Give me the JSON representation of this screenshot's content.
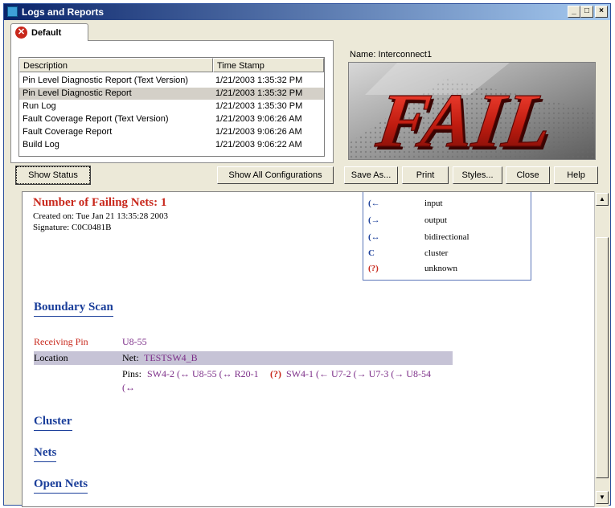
{
  "window": {
    "title": "Logs and Reports"
  },
  "tabs": [
    {
      "label": "Default"
    }
  ],
  "list": {
    "columns": [
      "Description",
      "Time Stamp"
    ],
    "rows": [
      {
        "description": "Pin Level Diagnostic Report (Text Version)",
        "time": "1/21/2003 1:35:32 PM"
      },
      {
        "description": "Pin Level Diagnostic Report",
        "time": "1/21/2003 1:35:32 PM",
        "selected": true
      },
      {
        "description": "Run Log",
        "time": "1/21/2003 1:35:30 PM"
      },
      {
        "description": "Fault Coverage Report (Text Version)",
        "time": "1/21/2003 9:06:26 AM"
      },
      {
        "description": "Fault Coverage Report",
        "time": "1/21/2003 9:06:26 AM"
      },
      {
        "description": "Build Log",
        "time": "1/21/2003 9:06:22 AM"
      }
    ]
  },
  "preview": {
    "name_label": "Name: Interconnect1",
    "fail_text": "FAIL"
  },
  "buttons": {
    "show_status": "Show Status",
    "show_all": "Show All Configurations",
    "save_as": "Save As...",
    "print": "Print",
    "styles": "Styles...",
    "close": "Close",
    "help": "Help"
  },
  "report": {
    "heading": "Number of Failing Nets: 1",
    "created": "Created on: Tue Jan 21 13:35:28 2003",
    "signature": "Signature: C0C0481B",
    "legend": [
      {
        "symbol": "(←",
        "label": "input"
      },
      {
        "symbol": "(→",
        "label": "output"
      },
      {
        "symbol": "(↔",
        "label": "bidirectional"
      },
      {
        "symbol": "C",
        "label": "cluster"
      },
      {
        "symbol": "(?)",
        "label": "unknown"
      }
    ],
    "boundary_scan": "Boundary Scan",
    "receiving_pin_label": "Receiving Pin",
    "receiving_pin_value": "U8-55",
    "location_label": "Location",
    "net_label": "Net:",
    "net_value": "TESTSW4_B",
    "pins_label": "Pins:",
    "pins_line1": "SW4-2 (↔ U8-55 (↔ R20-1",
    "pins_unknown": "(?)",
    "pins_line1b": "SW4-1 (← U7-2 (→ U7-3 (→ U8-54",
    "pins_line2": "(↔",
    "cluster": "Cluster",
    "nets": "Nets",
    "open_nets": "Open Nets"
  },
  "colors": {
    "title_bar": "#0a246a",
    "link_blue": "#1a3e9a",
    "fail_red": "#c8281c",
    "pin_purple": "#7b2c87"
  }
}
